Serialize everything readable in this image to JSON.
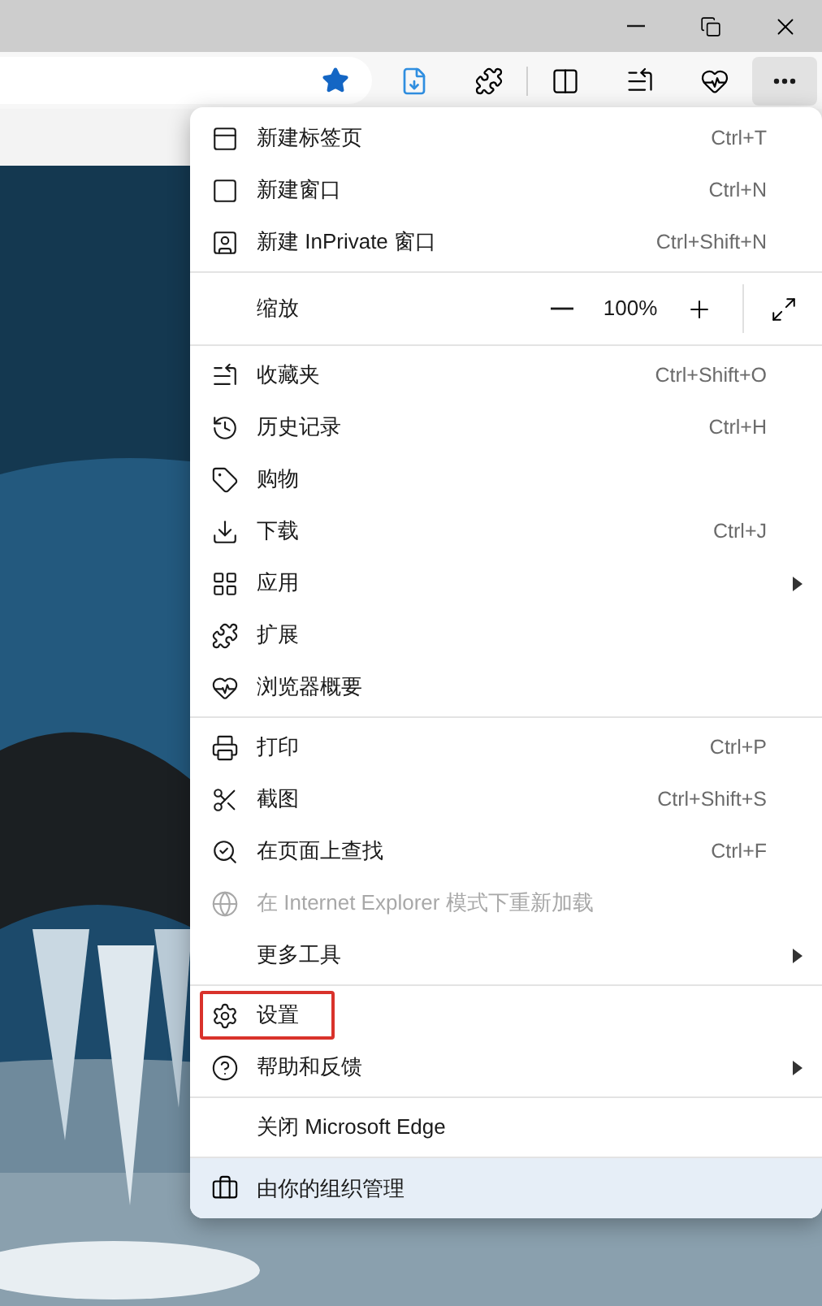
{
  "toolbar": {
    "menu_open": true
  },
  "menu": {
    "sections": [
      [
        {
          "kind": "item",
          "label": "新建标签页",
          "shortcut": "Ctrl+T",
          "submenu": false,
          "disabled": false,
          "highlighted": false
        },
        {
          "kind": "item",
          "label": "新建窗口",
          "shortcut": "Ctrl+N",
          "submenu": false,
          "disabled": false,
          "highlighted": false
        },
        {
          "kind": "item",
          "label": "新建 InPrivate 窗口",
          "shortcut": "Ctrl+Shift+N",
          "submenu": false,
          "disabled": false,
          "highlighted": false
        }
      ],
      [
        {
          "kind": "zoom",
          "label": "缩放",
          "value": "100%"
        }
      ],
      [
        {
          "kind": "item",
          "label": "收藏夹",
          "shortcut": "Ctrl+Shift+O",
          "submenu": false,
          "disabled": false,
          "highlighted": false
        },
        {
          "kind": "item",
          "label": "历史记录",
          "shortcut": "Ctrl+H",
          "submenu": false,
          "disabled": false,
          "highlighted": false
        },
        {
          "kind": "item",
          "label": "购物",
          "submenu": false,
          "disabled": false,
          "highlighted": false
        },
        {
          "kind": "item",
          "label": "下载",
          "shortcut": "Ctrl+J",
          "submenu": false,
          "disabled": false,
          "highlighted": false
        },
        {
          "kind": "item",
          "label": "应用",
          "submenu": true,
          "disabled": false,
          "highlighted": false
        },
        {
          "kind": "item",
          "label": "扩展",
          "submenu": false,
          "disabled": false,
          "highlighted": false
        },
        {
          "kind": "item",
          "label": "浏览器概要",
          "submenu": false,
          "disabled": false,
          "highlighted": false
        }
      ],
      [
        {
          "kind": "item",
          "label": "打印",
          "shortcut": "Ctrl+P",
          "submenu": false,
          "disabled": false,
          "highlighted": false
        },
        {
          "kind": "item",
          "label": "截图",
          "shortcut": "Ctrl+Shift+S",
          "submenu": false,
          "disabled": false,
          "highlighted": false
        },
        {
          "kind": "item",
          "label": "在页面上查找",
          "shortcut": "Ctrl+F",
          "submenu": false,
          "disabled": false,
          "highlighted": false
        },
        {
          "kind": "item",
          "label": "在 Internet Explorer 模式下重新加载",
          "submenu": false,
          "disabled": true,
          "highlighted": false
        },
        {
          "kind": "item",
          "label": "更多工具",
          "submenu": true,
          "disabled": false,
          "highlighted": false
        }
      ],
      [
        {
          "kind": "item",
          "label": "设置",
          "submenu": false,
          "disabled": false,
          "highlighted": true
        },
        {
          "kind": "item",
          "label": "帮助和反馈",
          "submenu": true,
          "disabled": false,
          "highlighted": false
        }
      ],
      [
        {
          "kind": "item",
          "label": "关闭 Microsoft Edge",
          "submenu": false,
          "disabled": false,
          "highlighted": false
        }
      ]
    ],
    "footer": {
      "label": "由你的组织管理"
    }
  }
}
